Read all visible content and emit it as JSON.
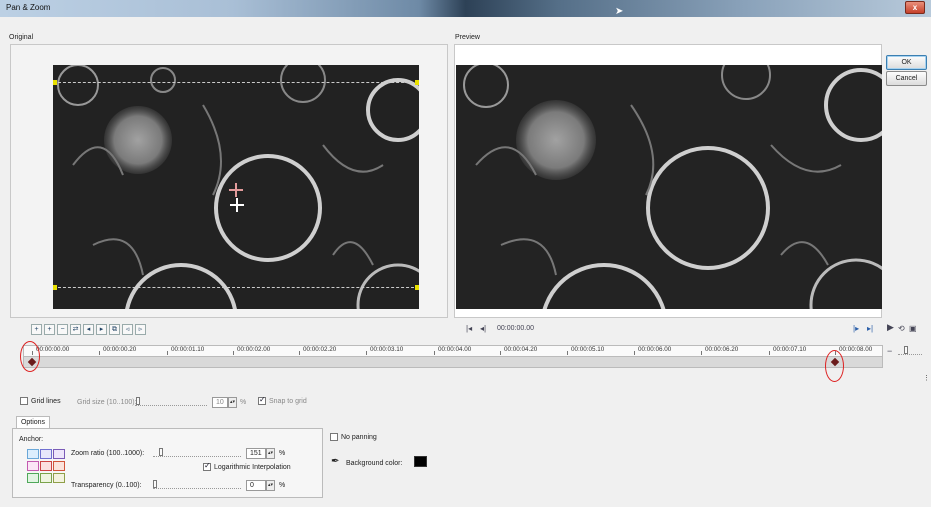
{
  "window": {
    "title": "Pan & Zoom",
    "close_label": "x"
  },
  "panels": {
    "original_label": "Original",
    "preview_label": "Preview"
  },
  "buttons": {
    "ok_label": "OK",
    "cancel_label": "Cancel"
  },
  "playback": {
    "time": "00:00:00.00"
  },
  "timeline": {
    "ticks": [
      "00:00:00.00",
      "00:00:00.20",
      "00:00:01.10",
      "00:00:02.00",
      "00:00:02.20",
      "00:00:03.10",
      "00:00:04.00",
      "00:00:04.20",
      "00:00:05.10",
      "00:00:06.00",
      "00:00:06.20",
      "00:00:07.10",
      "00:00:08.00"
    ]
  },
  "grid": {
    "grid_lines_label": "Grid lines",
    "grid_size_label": "Grid size (10..100):",
    "grid_size_value": "10",
    "grid_size_unit": "%",
    "snap_label": "Snap to grid"
  },
  "options": {
    "tab_label": "Options",
    "anchor_label": "Anchor:",
    "zoom_label": "Zoom ratio (100..1000):",
    "zoom_value": "151",
    "zoom_unit": "%",
    "log_label": "Logarithmic Interpolation",
    "transparency_label": "Transparency (0..100):",
    "transparency_value": "0",
    "transparency_unit": "%",
    "no_panning_label": "No panning",
    "bg_color_label": "Background color:",
    "bg_color": "#000000"
  },
  "colors": {
    "keyframe_marker": "#6b1c1c",
    "highlight_circle": "#dd2222",
    "selection_handle": "#e8e000"
  }
}
